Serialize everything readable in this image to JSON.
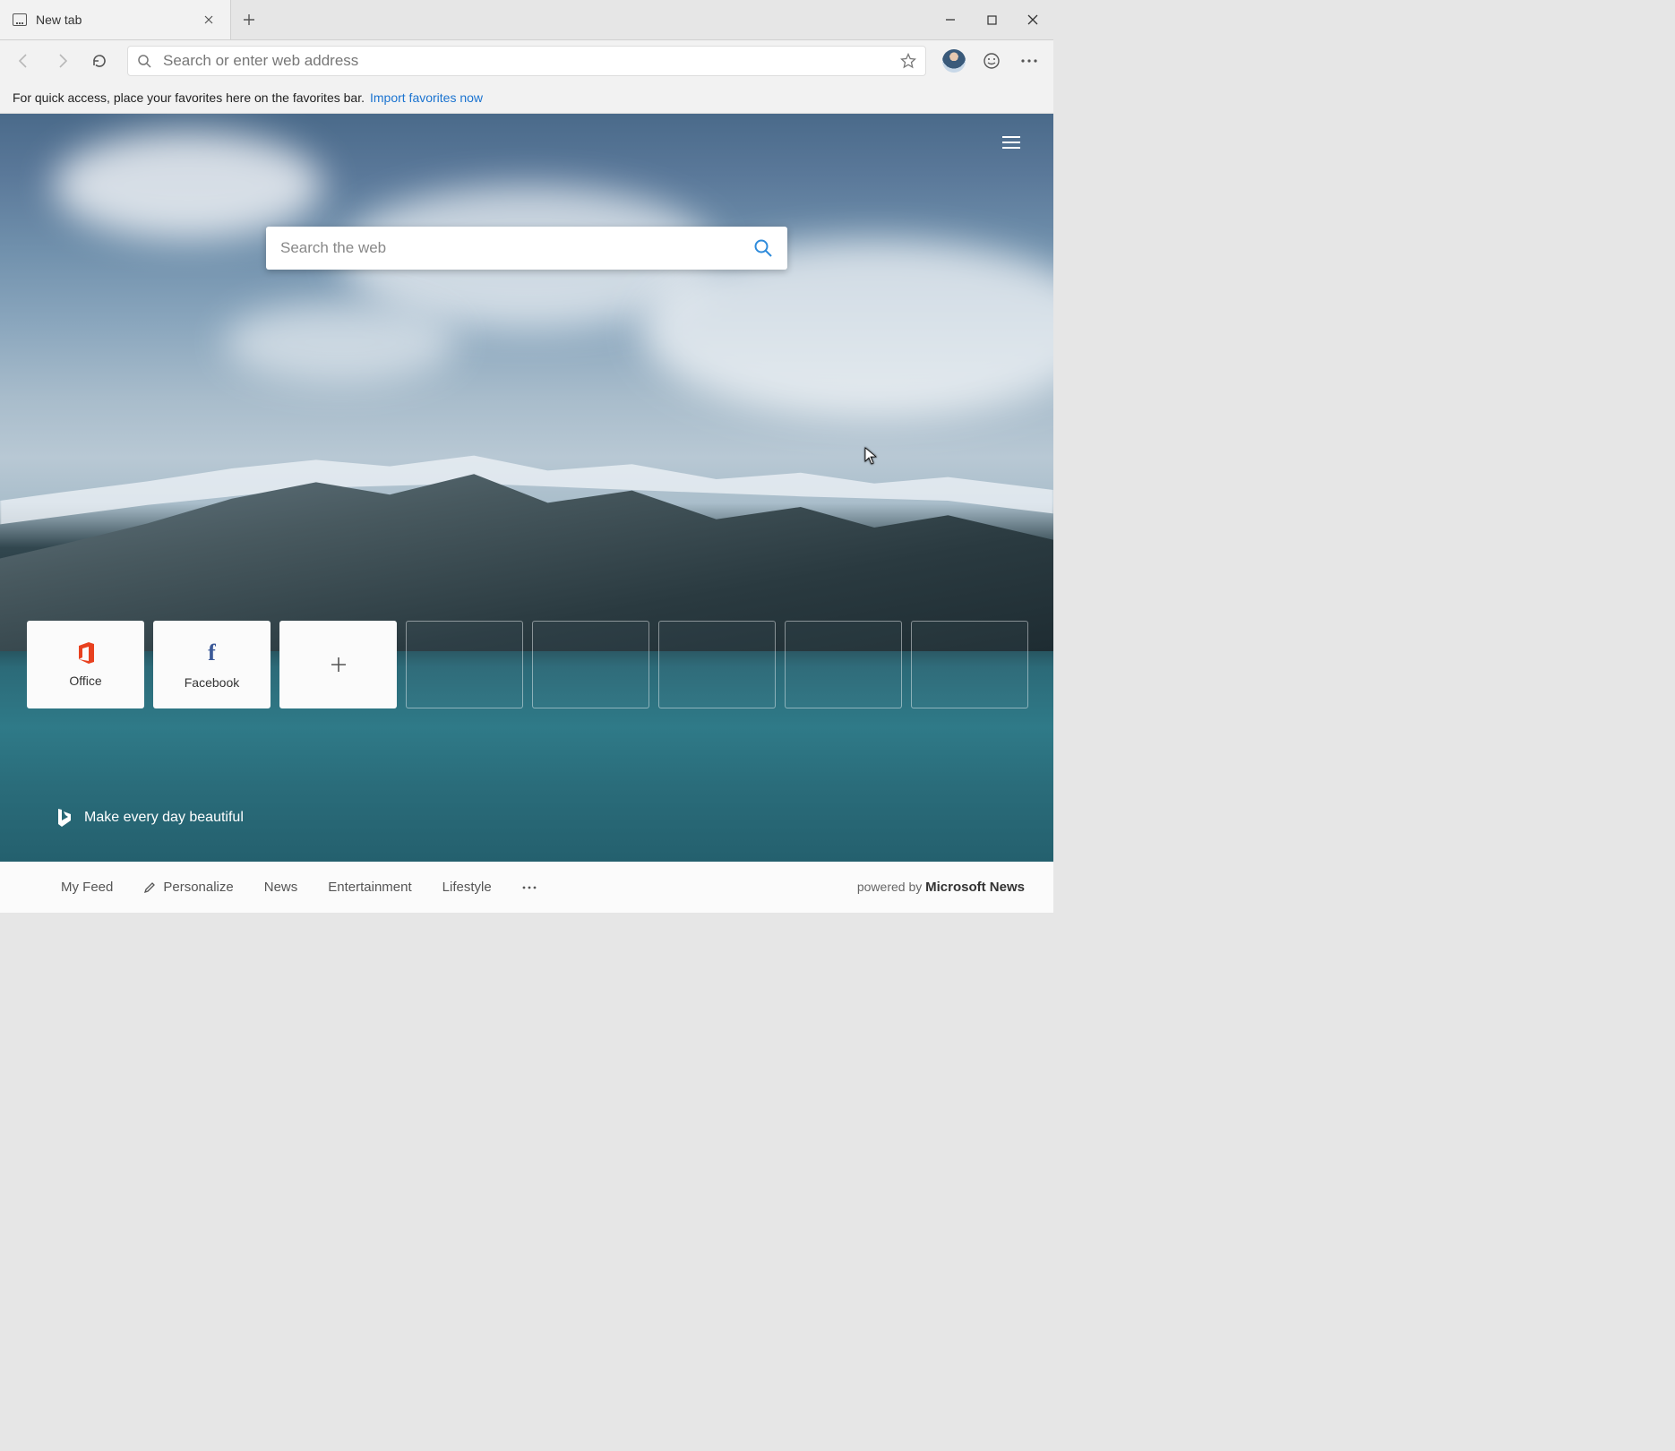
{
  "tab": {
    "title": "New tab"
  },
  "toolbar": {
    "omnibox_placeholder": "Search or enter web address"
  },
  "favorites_hint": {
    "text": "For quick access, place your favorites here on the favorites bar.",
    "link": "Import favorites now"
  },
  "ntp": {
    "search_placeholder": "Search the web",
    "tiles": [
      {
        "label": "Office",
        "icon": "office"
      },
      {
        "label": "Facebook",
        "icon": "facebook"
      }
    ],
    "tagline": "Make every day beautiful"
  },
  "feedbar": {
    "items": [
      "My Feed",
      "Personalize",
      "News",
      "Entertainment",
      "Lifestyle"
    ],
    "powered_prefix": "powered by",
    "powered_brand": "Microsoft News"
  }
}
